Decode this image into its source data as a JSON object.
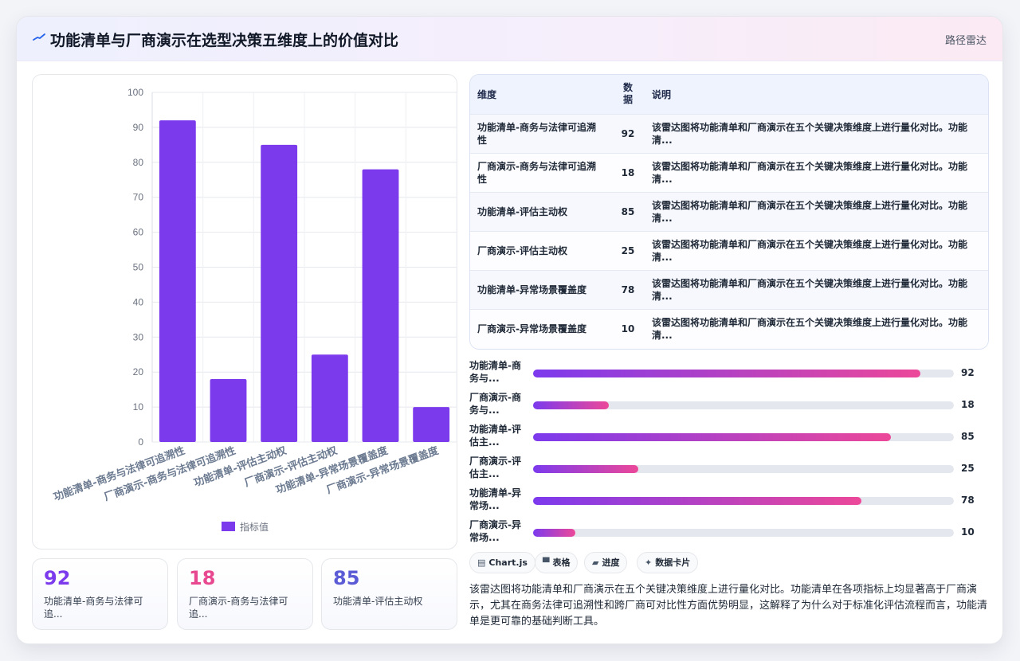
{
  "header": {
    "title": "功能清单与厂商演示在选型决策五维度上的价值对比",
    "tag": "路径雷达",
    "logo_icon": "signal-icon"
  },
  "chart_data": {
    "type": "bar",
    "categories": [
      "功能清单-商务与法律可追溯性",
      "厂商演示-商务与法律可追溯性",
      "功能清单-评估主动权",
      "厂商演示-评估主动权",
      "功能清单-异常场景覆盖度",
      "厂商演示-异常场景覆盖度"
    ],
    "series": [
      {
        "name": "指标值",
        "values": [
          92,
          18,
          85,
          25,
          78,
          10
        ],
        "color": "#7c3aed"
      }
    ],
    "ylim": [
      0,
      100
    ],
    "yticks": [
      "0",
      "10",
      "20",
      "30",
      "40",
      "50",
      "60",
      "70",
      "80",
      "90",
      "100"
    ],
    "legend": "bottom",
    "grid": true
  },
  "stats": [
    {
      "value": "92",
      "label": "功能清单-商务与法律可追...",
      "color": "#7c3aed"
    },
    {
      "value": "18",
      "label": "厂商演示-商务与法律可追...",
      "color": "#e8488f"
    },
    {
      "value": "85",
      "label": "功能清单-评估主动权",
      "color": "#5b5bd6"
    }
  ],
  "table": {
    "headers": {
      "dim": "维度",
      "val": "数据",
      "desc": "说明"
    },
    "rows": [
      {
        "dim": "功能清单-商务与法律可追溯性",
        "val": "92",
        "desc": "该雷达图将功能清单和厂商演示在五个关键决策维度上进行量化对比。功能清..."
      },
      {
        "dim": "厂商演示-商务与法律可追溯性",
        "val": "18",
        "desc": "该雷达图将功能清单和厂商演示在五个关键决策维度上进行量化对比。功能清..."
      },
      {
        "dim": "功能清单-评估主动权",
        "val": "85",
        "desc": "该雷达图将功能清单和厂商演示在五个关键决策维度上进行量化对比。功能清..."
      },
      {
        "dim": "厂商演示-评估主动权",
        "val": "25",
        "desc": "该雷达图将功能清单和厂商演示在五个关键决策维度上进行量化对比。功能清..."
      },
      {
        "dim": "功能清单-异常场景覆盖度",
        "val": "78",
        "desc": "该雷达图将功能清单和厂商演示在五个关键决策维度上进行量化对比。功能清..."
      },
      {
        "dim": "厂商演示-异常场景覆盖度",
        "val": "10",
        "desc": "该雷达图将功能清单和厂商演示在五个关键决策维度上进行量化对比。功能清..."
      }
    ]
  },
  "progress": [
    {
      "label": "功能清单-商务与...",
      "value": 92
    },
    {
      "label": "厂商演示-商务与...",
      "value": 18
    },
    {
      "label": "功能清单-评估主...",
      "value": 85
    },
    {
      "label": "厂商演示-评估主...",
      "value": 25
    },
    {
      "label": "功能清单-异常场...",
      "value": 78
    },
    {
      "label": "厂商演示-异常场...",
      "value": 10
    }
  ],
  "chips": [
    {
      "icon": "chart-icon",
      "glyph": "▤",
      "label": "Chart.js"
    },
    {
      "icon": "table-icon",
      "glyph": "▀",
      "label": "表格"
    },
    {
      "icon": "progress-icon",
      "glyph": "▰",
      "label": "进度"
    },
    {
      "icon": "sparkle-icon",
      "glyph": "✦",
      "label": "数据卡片"
    }
  ],
  "summary": "该雷达图将功能清单和厂商演示在五个关键决策维度上进行量化对比。功能清单在各项指标上均显著高于厂商演示，尤其在商务法律可追溯性和跨厂商可对比性方面优势明显，这解释了为什么对于标准化评估流程而言，功能清单是更可靠的基础判断工具。"
}
